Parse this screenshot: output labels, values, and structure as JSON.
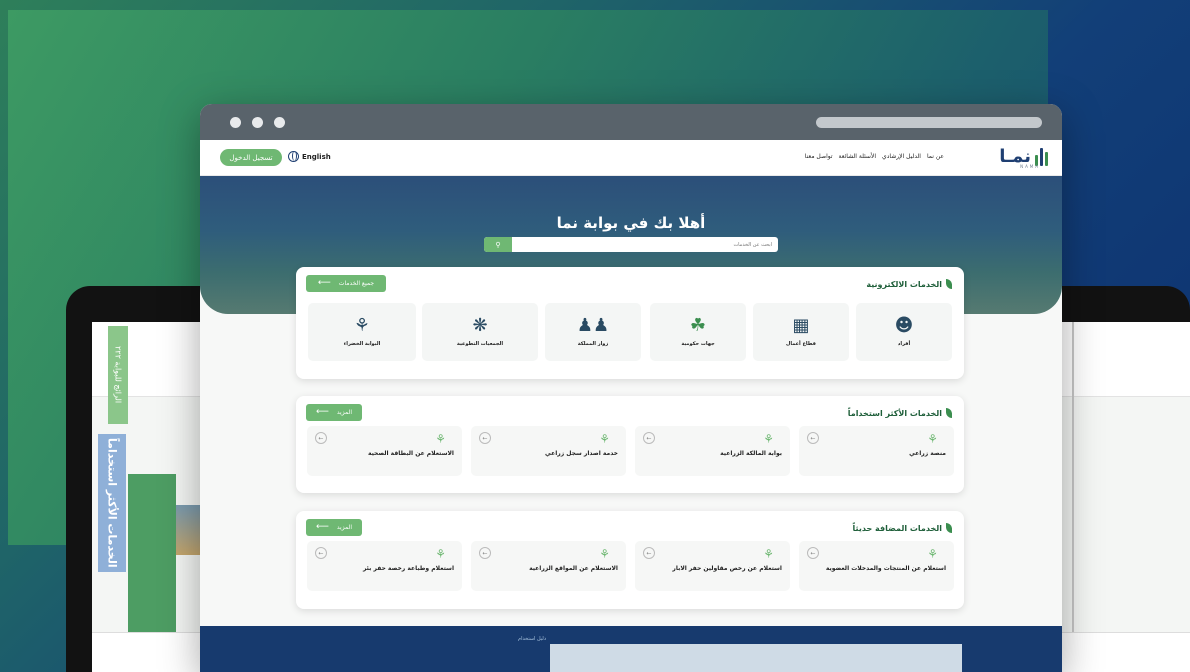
{
  "colors": {
    "primary_green": "#6fb873",
    "navy": "#1f3f72",
    "footer": "#173a6e"
  },
  "background_laptop": {
    "green_tab": "الرائج للبوابة ٢٢٢",
    "blue_tab": "الخدمات الأكثر استخداماً"
  },
  "header": {
    "login_label": "تسجيل الدخول",
    "language_label": "English",
    "nav_links": [
      "عن نما",
      "الدليل الإرشادي",
      "الأسئلة الشائعة",
      "تواصل معنا"
    ],
    "logo_text": "نمـا",
    "logo_sub": "NAMA"
  },
  "hero": {
    "title": "أهلا بك في بوابة نما",
    "search_placeholder": "ابحث عن الخدمات",
    "search_icon": "search-icon"
  },
  "eservices": {
    "title": "الخدمات الالكترونية",
    "all_button": "جميع الخدمات",
    "categories": [
      {
        "label": "أفراد",
        "icon": "person-icon"
      },
      {
        "label": "قطاع أعمال",
        "icon": "building-icon"
      },
      {
        "label": "جهات حكومية",
        "icon": "palm-emblem-icon"
      },
      {
        "label": "زوار المملكة",
        "icon": "visitors-icon"
      },
      {
        "label": "الجمعيات التطوعية",
        "icon": "network-icon"
      },
      {
        "label": "البوابة الخضراء",
        "icon": "green-portal-icon"
      }
    ]
  },
  "most_used": {
    "title": "الخدمات الأكثر استخداماً",
    "more_button": "المزيد",
    "items": [
      {
        "label": "منصة زراعي",
        "icon": "plant-icon"
      },
      {
        "label": "بوابة المالكة الزراعية",
        "icon": "plant-icon"
      },
      {
        "label": "خدمة اصدار سجل زراعي",
        "icon": "plant-icon"
      },
      {
        "label": "الاستعلام عن البطاقة الصحية",
        "icon": "plant-icon"
      }
    ]
  },
  "new_services": {
    "title": "الخدمات المضافة حديثاً",
    "more_button": "المزيد",
    "items": [
      {
        "label": "استعلام عن المنتجات والمدخلات العضوية",
        "icon": "plant-icon"
      },
      {
        "label": "استعلام عن رخص مقاولين حفر الابار",
        "icon": "plant-icon"
      },
      {
        "label": "الاستعلام عن المواقع الزراعية",
        "icon": "plant-icon"
      },
      {
        "label": "استعلام وطباعة رخصة حفر بئر",
        "icon": "plant-icon"
      }
    ]
  },
  "footer": {
    "label": "دليل استخدام"
  }
}
